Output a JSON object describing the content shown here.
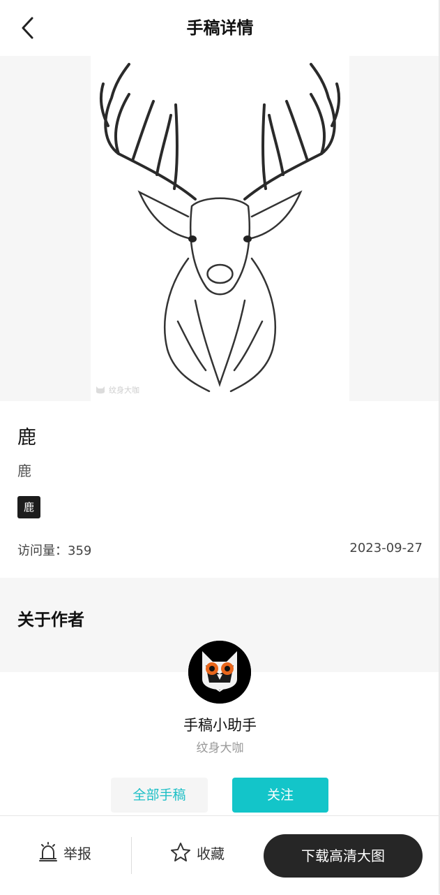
{
  "header": {
    "title": "手稿详情",
    "back_icon": "chevron-left-icon"
  },
  "artwork": {
    "watermark": "纹身大咖",
    "image_semantic": "deer-head-sketch"
  },
  "info": {
    "title": "鹿",
    "subtitle": "鹿",
    "tag": "鹿",
    "views": "访问量：359",
    "date": "2023-09-27"
  },
  "author_section": {
    "heading": "关于作者",
    "name": "手稿小助手",
    "role": "纹身大咖",
    "avatar_icon": "owl-avatar",
    "all_works_label": "全部手稿",
    "follow_label": "关注"
  },
  "bottom_bar": {
    "report_label": "举报",
    "report_icon": "alarm-icon",
    "favorite_label": "收藏",
    "favorite_icon": "star-outline-icon",
    "download_label": "下载高清大图"
  },
  "colors": {
    "accent": "#13c5c9",
    "accent_text": "#1dbfc6",
    "dark": "#262626",
    "section_bg": "#f6f6f6"
  }
}
